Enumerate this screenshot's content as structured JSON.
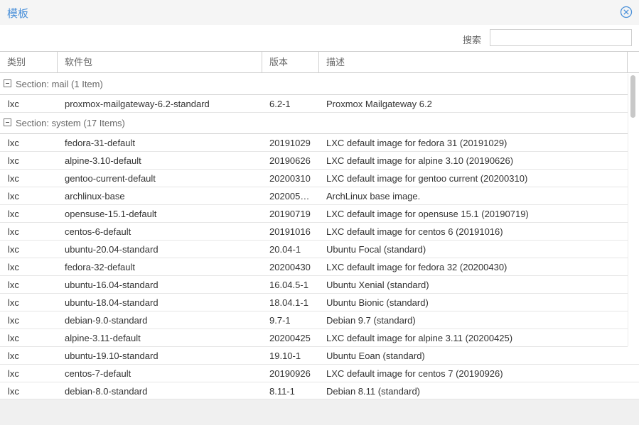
{
  "window": {
    "title": "模板"
  },
  "toolbar": {
    "search_label": "搜索",
    "search_value": "",
    "search_placeholder": ""
  },
  "columns": {
    "type": "类别",
    "package": "软件包",
    "version": "版本",
    "description": "描述"
  },
  "groups": [
    {
      "label": "Section: mail (1 Item)",
      "rows": [
        {
          "type": "lxc",
          "package": "proxmox-mailgateway-6.2-standard",
          "version": "6.2-1",
          "description": "Proxmox Mailgateway 6.2"
        }
      ]
    },
    {
      "label": "Section: system (17 Items)",
      "rows": [
        {
          "type": "lxc",
          "package": "fedora-31-default",
          "version": "20191029",
          "description": "LXC default image for fedora 31 (20191029)"
        },
        {
          "type": "lxc",
          "package": "alpine-3.10-default",
          "version": "20190626",
          "description": "LXC default image for alpine 3.10 (20190626)"
        },
        {
          "type": "lxc",
          "package": "gentoo-current-default",
          "version": "20200310",
          "description": "LXC default image for gentoo current (20200310)"
        },
        {
          "type": "lxc",
          "package": "archlinux-base",
          "version": "202005…",
          "description": "ArchLinux base image."
        },
        {
          "type": "lxc",
          "package": "opensuse-15.1-default",
          "version": "20190719",
          "description": "LXC default image for opensuse 15.1 (20190719)"
        },
        {
          "type": "lxc",
          "package": "centos-6-default",
          "version": "20191016",
          "description": "LXC default image for centos 6 (20191016)"
        },
        {
          "type": "lxc",
          "package": "ubuntu-20.04-standard",
          "version": "20.04-1",
          "description": "Ubuntu Focal (standard)"
        },
        {
          "type": "lxc",
          "package": "fedora-32-default",
          "version": "20200430",
          "description": "LXC default image for fedora 32 (20200430)"
        },
        {
          "type": "lxc",
          "package": "ubuntu-16.04-standard",
          "version": "16.04.5-1",
          "description": "Ubuntu Xenial (standard)"
        },
        {
          "type": "lxc",
          "package": "ubuntu-18.04-standard",
          "version": "18.04.1-1",
          "description": "Ubuntu Bionic (standard)"
        },
        {
          "type": "lxc",
          "package": "debian-9.0-standard",
          "version": "9.7-1",
          "description": "Debian 9.7 (standard)"
        },
        {
          "type": "lxc",
          "package": "alpine-3.11-default",
          "version": "20200425",
          "description": "LXC default image for alpine 3.11 (20200425)"
        },
        {
          "type": "lxc",
          "package": "ubuntu-19.10-standard",
          "version": "19.10-1",
          "description": "Ubuntu Eoan (standard)"
        },
        {
          "type": "lxc",
          "package": "centos-7-default",
          "version": "20190926",
          "description": "LXC default image for centos 7 (20190926)"
        },
        {
          "type": "lxc",
          "package": "debian-8.0-standard",
          "version": "8.11-1",
          "description": "Debian 8.11 (standard)"
        }
      ]
    }
  ],
  "colors": {
    "accent": "#4a90d9",
    "border": "#cfcfcf",
    "header_text": "#666666",
    "footer_bg": "#f0f0f0"
  },
  "icons": {
    "close": "circle-x-icon",
    "group_toggle": "collapse-minus-icon"
  }
}
